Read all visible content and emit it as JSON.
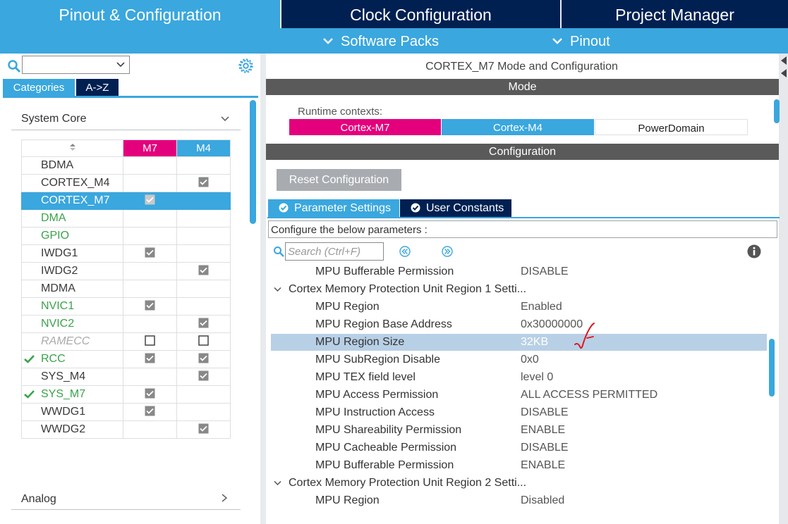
{
  "top_tabs": [
    {
      "label": "Pinout & Configuration",
      "active": true
    },
    {
      "label": "Clock Configuration",
      "active": false
    },
    {
      "label": "Project Manager",
      "active": false
    }
  ],
  "sub_menus": [
    {
      "label": "Software Packs"
    },
    {
      "label": "Pinout"
    }
  ],
  "left": {
    "search_value": "",
    "category_tabs": [
      "Categories",
      "A->Z"
    ],
    "group_title": "System Core",
    "columns": {
      "m7": "M7",
      "m4": "M4"
    },
    "peripherals": [
      {
        "name": "BDMA",
        "style": "normal",
        "m7": "",
        "m4": "",
        "selected": false,
        "ok": false
      },
      {
        "name": "CORTEX_M4",
        "style": "normal",
        "m7": "",
        "m4": "checked",
        "selected": false,
        "ok": false
      },
      {
        "name": "CORTEX_M7",
        "style": "normal",
        "m7": "checked",
        "m4": "",
        "selected": true,
        "ok": false
      },
      {
        "name": "DMA",
        "style": "green",
        "m7": "",
        "m4": "",
        "selected": false,
        "ok": false
      },
      {
        "name": "GPIO",
        "style": "green",
        "m7": "",
        "m4": "",
        "selected": false,
        "ok": false
      },
      {
        "name": "IWDG1",
        "style": "normal",
        "m7": "checked",
        "m4": "",
        "selected": false,
        "ok": false
      },
      {
        "name": "IWDG2",
        "style": "normal",
        "m7": "",
        "m4": "checked",
        "selected": false,
        "ok": false
      },
      {
        "name": "MDMA",
        "style": "normal",
        "m7": "",
        "m4": "",
        "selected": false,
        "ok": false
      },
      {
        "name": "NVIC1",
        "style": "green",
        "m7": "checked",
        "m4": "",
        "selected": false,
        "ok": false
      },
      {
        "name": "NVIC2",
        "style": "green",
        "m7": "",
        "m4": "checked",
        "selected": false,
        "ok": false
      },
      {
        "name": "RAMECC",
        "style": "gray",
        "m7": "empty",
        "m4": "empty",
        "selected": false,
        "ok": false
      },
      {
        "name": "RCC",
        "style": "green",
        "m7": "checked",
        "m4": "checked",
        "selected": false,
        "ok": true
      },
      {
        "name": "SYS_M4",
        "style": "normal",
        "m7": "",
        "m4": "checked",
        "selected": false,
        "ok": false
      },
      {
        "name": "SYS_M7",
        "style": "green",
        "m7": "checked",
        "m4": "",
        "selected": false,
        "ok": true
      },
      {
        "name": "WWDG1",
        "style": "normal",
        "m7": "checked",
        "m4": "",
        "selected": false,
        "ok": false
      },
      {
        "name": "WWDG2",
        "style": "normal",
        "m7": "",
        "m4": "checked",
        "selected": false,
        "ok": false
      }
    ],
    "next_group": "Analog"
  },
  "right": {
    "title": "CORTEX_M7 Mode and Configuration",
    "mode_header": "Mode",
    "runtime_label": "Runtime contexts:",
    "contexts": [
      "Cortex-M7",
      "Cortex-M4",
      "PowerDomain"
    ],
    "config_header": "Configuration",
    "reset_label": "Reset Configuration",
    "param_tabs": [
      "Parameter Settings",
      "User Constants"
    ],
    "configure_text": "Configure the below parameters :",
    "search_placeholder": "Search (Ctrl+F)",
    "params": [
      {
        "type": "param",
        "name": "MPU Bufferable  Permission",
        "value": "DISABLE"
      },
      {
        "type": "group",
        "name": "Cortex Memory Protection Unit Region 1 Setti..."
      },
      {
        "type": "param",
        "name": "MPU Region",
        "value": "Enabled"
      },
      {
        "type": "param",
        "name": "MPU Region Base Address",
        "value": "0x30000000"
      },
      {
        "type": "param",
        "name": "MPU Region Size",
        "value": "32KB",
        "highlight": true
      },
      {
        "type": "param",
        "name": "MPU SubRegion Disable",
        "value": "0x0"
      },
      {
        "type": "param",
        "name": "MPU TEX field level",
        "value": "level 0"
      },
      {
        "type": "param",
        "name": "MPU Access Permission",
        "value": "ALL ACCESS PERMITTED"
      },
      {
        "type": "param",
        "name": "MPU Instruction Access",
        "value": "DISABLE"
      },
      {
        "type": "param",
        "name": "MPU Shareability Permission",
        "value": "ENABLE"
      },
      {
        "type": "param",
        "name": "MPU Cacheable Permission",
        "value": "DISABLE"
      },
      {
        "type": "param",
        "name": "MPU Bufferable  Permission",
        "value": "ENABLE"
      },
      {
        "type": "group",
        "name": "Cortex Memory Protection Unit Region 2 Setti..."
      },
      {
        "type": "param",
        "name": "MPU Region",
        "value": "Disabled"
      }
    ]
  },
  "colors": {
    "dark_navy": "#002052",
    "accent_blue": "#3aa7de",
    "m7_pink": "#e4007c",
    "ok_green": "#3aa34a",
    "header_gray": "#5a5a5a"
  },
  "icons": [
    "search-icon",
    "gear-icon",
    "chevron-down-icon",
    "chevron-right-icon",
    "sort-icon",
    "check-icon",
    "ok-circle-icon",
    "info-icon",
    "prev-icon",
    "next-icon"
  ]
}
